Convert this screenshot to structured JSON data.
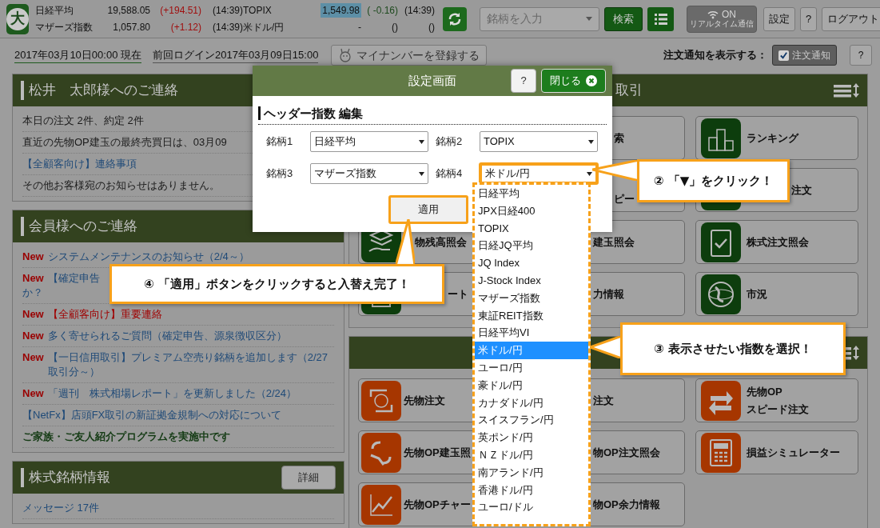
{
  "header": {
    "logo_text": "大",
    "indices": [
      {
        "name": "日経平均",
        "value": "19,588.05",
        "change": "(+194.51)",
        "color": "#a01010",
        "time": "(14:39)",
        "highlighted": false
      },
      {
        "name": "TOPIX",
        "value": "1,549.98",
        "change": "( -0.16)",
        "color": "#1e4a1e",
        "time": "(14:39)",
        "highlighted": true
      },
      {
        "name": "マザーズ指数",
        "value": "1,057.80",
        "change": "(+1.12)",
        "color": "#a01010",
        "time": "(14:39)",
        "highlighted": false
      },
      {
        "name": "米ドル/円",
        "value": "-",
        "change": "()",
        "color": "#111111",
        "time": "()",
        "highlighted": false
      }
    ],
    "search": {
      "placeholder": "銘柄を入力"
    },
    "search_button": "検索",
    "realtime": {
      "state": "ON",
      "label": "リアルタイム通信",
      "on": true
    },
    "buttons": [
      "設定",
      "?",
      "ログアウト"
    ]
  },
  "info_bar": {
    "as_of": "2017年03月10日00:00 現在",
    "last_login": "前回ログイン2017年03月09日15:00",
    "mynumber_button": "マイナンバーを登録する",
    "notify_label": "注文通知を表示する：",
    "notify_toggle": {
      "label": "注文通知",
      "checked": true
    },
    "help": "?"
  },
  "left_panels": [
    {
      "title": "松井　太郎様へのご連絡",
      "rows": [
        {
          "kind": "text",
          "text": "本日の注文 2件、約定 2件"
        },
        {
          "kind": "text",
          "text": "直近の先物OP建玉の最終売買日は、03月09"
        },
        {
          "kind": "link",
          "text": "【全顧客向け】連絡事項"
        },
        {
          "kind": "text",
          "text": "その他お客様宛のお知らせはありません。"
        }
      ]
    },
    {
      "title": "会員様へのご連絡",
      "rows": [
        {
          "kind": "link",
          "badge": "New",
          "text": "システムメンテナンスのお知らせ（2/4～）"
        },
        {
          "kind": "link",
          "badge": "New",
          "text": "【確定申告",
          "continued": "か？"
        },
        {
          "kind": "alert",
          "badge": "New",
          "text": "【全顧客向け】重要連絡"
        },
        {
          "kind": "link",
          "badge": "New",
          "text": "多く寄せられるご質問（確定申告、源泉徴収区分）"
        },
        {
          "kind": "link",
          "badge": "New",
          "text": "【一日信用取引】プレミアム空売り銘柄を追加します（2/27取引分～）"
        },
        {
          "kind": "link",
          "badge": "New",
          "text": "「週刊　株式相場レポート」を更新しました（2/24）"
        },
        {
          "kind": "link",
          "text": "【NetFx】店頭FX取引の新証拠金規制への対応について"
        },
        {
          "kind": "bold",
          "text": "ご家族・ご友人紹介プログラムを実施中です"
        }
      ]
    },
    {
      "title": "株式銘柄情報",
      "button": "詳細",
      "rows": [
        {
          "kind": "link",
          "text": "メッセージ 17件"
        }
      ]
    }
  ],
  "right_panels": [
    {
      "title": "取引",
      "kind": "stock",
      "tiles": [
        {
          "label": "索"
        },
        {
          "label": "ランキング"
        },
        {
          "label": "ピー"
        },
        {
          "label": "注文"
        },
        {
          "label": "物残高照会"
        },
        {
          "label": "建玉照会"
        },
        {
          "label": "株式注文照会"
        },
        {
          "label": "ート"
        },
        {
          "label": "力情報"
        },
        {
          "label": "市況"
        }
      ]
    },
    {
      "kind": "futures",
      "tiles": [
        {
          "label": "先物注文"
        },
        {
          "label": "注文"
        },
        {
          "label": "先物OP\nスピード注文"
        },
        {
          "label": "先物OP建玉照"
        },
        {
          "label": "物OP注文照会"
        },
        {
          "label": "損益シミュレーター"
        },
        {
          "label": "先物OPチャー"
        },
        {
          "label": "物OP余力情報"
        }
      ]
    }
  ],
  "modal": {
    "title": "設定画面",
    "help": "?",
    "close": "閉じる",
    "section": "ヘッダー指数 編集",
    "fields": [
      {
        "label": "銘柄1",
        "value": "日経平均",
        "highlighted": false
      },
      {
        "label": "銘柄2",
        "value": "TOPIX",
        "highlighted": false
      },
      {
        "label": "銘柄3",
        "value": "マザーズ指数",
        "highlighted": false
      },
      {
        "label": "銘柄4",
        "value": "米ドル/円",
        "highlighted": true
      }
    ],
    "apply": {
      "label": "適用",
      "highlighted": true
    },
    "options": [
      {
        "label": "日経平均",
        "selected": false
      },
      {
        "label": "JPX日経400",
        "selected": false
      },
      {
        "label": "TOPIX",
        "selected": false
      },
      {
        "label": "日経JQ平均",
        "selected": false
      },
      {
        "label": "JQ Index",
        "selected": false
      },
      {
        "label": "J-Stock Index",
        "selected": false
      },
      {
        "label": "マザーズ指数",
        "selected": false
      },
      {
        "label": "東証REIT指数",
        "selected": false
      },
      {
        "label": "日経平均VI",
        "selected": false
      },
      {
        "label": "米ドル/円",
        "selected": true
      },
      {
        "label": "ユーロ/円",
        "selected": false
      },
      {
        "label": "豪ドル/円",
        "selected": false
      },
      {
        "label": "カナダドル/円",
        "selected": false
      },
      {
        "label": "スイスフラン/円",
        "selected": false
      },
      {
        "label": "英ポンド/円",
        "selected": false
      },
      {
        "label": "ＮＺドル/円",
        "selected": false
      },
      {
        "label": "南アランド/円",
        "selected": false
      },
      {
        "label": "香港ドル/円",
        "selected": false
      },
      {
        "label": "ユーロ/ドル",
        "selected": false
      }
    ]
  },
  "callouts": [
    {
      "kind": "select",
      "text": "② 「▼」をクリック！"
    },
    {
      "kind": "option",
      "text": "③ 表示させたい指数を選択！"
    },
    {
      "kind": "apply",
      "text": "④ 「適用」ボタンをクリックすると入替え完了！"
    }
  ]
}
